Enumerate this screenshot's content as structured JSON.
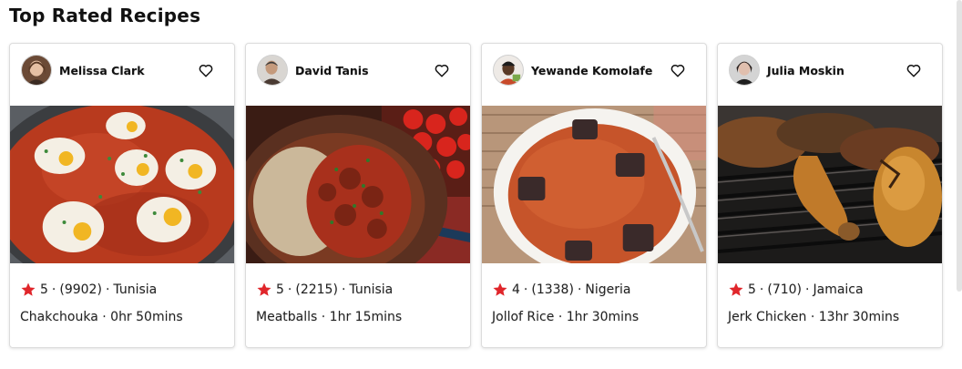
{
  "section_title": "Top Rated Recipes",
  "colors": {
    "star": "#e0262b",
    "accent": "#111111"
  },
  "recipes": [
    {
      "author": "Melissa Clark",
      "rating": "5",
      "reviews": "(9902)",
      "country": "Tunisia",
      "name": "Chakchouka",
      "time": "0hr 50mins",
      "favorite_icon": "heart-outline-icon"
    },
    {
      "author": "David Tanis",
      "rating": "5",
      "reviews": "(2215)",
      "country": "Tunisia",
      "name": "Meatballs",
      "time": "1hr 15mins",
      "favorite_icon": "heart-outline-icon"
    },
    {
      "author": "Yewande Komolafe",
      "rating": "4",
      "reviews": "(1338)",
      "country": "Nigeria",
      "name": "Jollof Rice",
      "time": "1hr 30mins",
      "favorite_icon": "heart-outline-icon"
    },
    {
      "author": "Julia Moskin",
      "rating": "5",
      "reviews": "(710)",
      "country": "Jamaica",
      "name": "Jerk Chicken",
      "time": "13hr 30mins",
      "favorite_icon": "heart-outline-icon"
    }
  ],
  "separator": "·"
}
